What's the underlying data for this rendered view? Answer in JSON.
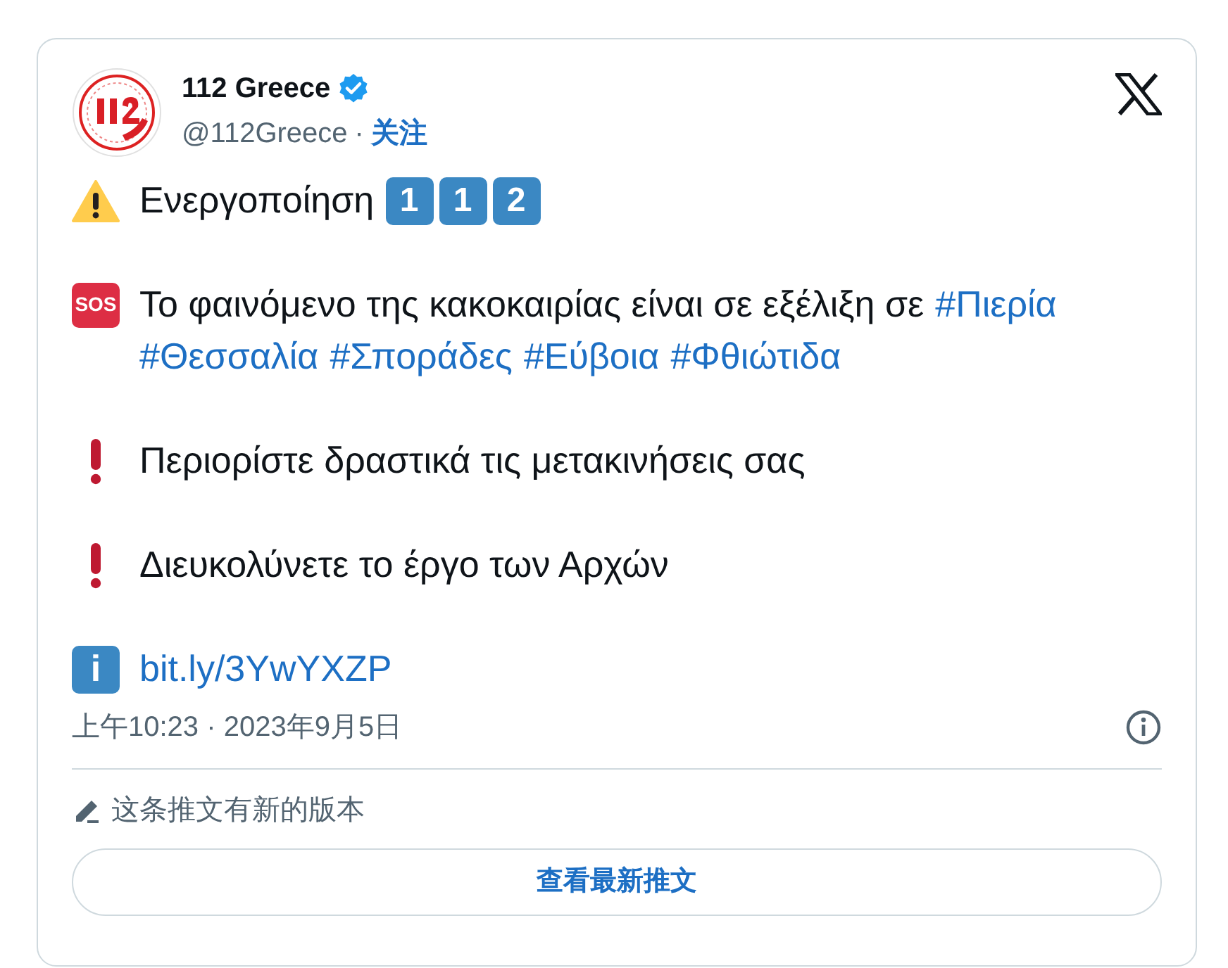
{
  "author": {
    "name": "112 Greece",
    "verified": true,
    "handle": "@112Greece",
    "separator": "·",
    "follow": "关注"
  },
  "paragraphs": [
    {
      "marker": {
        "kind": "warning"
      },
      "parts": [
        {
          "kind": "text",
          "text": "Ενεργοποίηση"
        },
        {
          "kind": "keycap",
          "text": "1"
        },
        {
          "kind": "keycap",
          "text": "1"
        },
        {
          "kind": "keycap",
          "text": "2"
        }
      ]
    },
    {
      "marker": {
        "kind": "badge",
        "text": "SOS"
      },
      "parts": [
        {
          "kind": "text",
          "text": "Το φαινόμενο της κακοκαιρίας είναι σε εξέλιξη σε"
        },
        {
          "kind": "hashtag",
          "text": "#Πιερία"
        },
        {
          "kind": "hashtag",
          "text": "#Θεσσαλία"
        },
        {
          "kind": "hashtag",
          "text": "#Σποράδες"
        },
        {
          "kind": "hashtag",
          "text": "#Εύβοια"
        },
        {
          "kind": "hashtag",
          "text": "#Φθιώτιδα"
        }
      ]
    },
    {
      "marker": {
        "kind": "exclamation"
      },
      "parts": [
        {
          "kind": "text",
          "text": "Περιορίστε δραστικά τις μετακινήσεις σας"
        }
      ]
    },
    {
      "marker": {
        "kind": "exclamation"
      },
      "parts": [
        {
          "kind": "text",
          "text": "Διευκολύνετε το έργο των Αρχών"
        }
      ]
    },
    {
      "marker": {
        "kind": "info",
        "text": "i"
      },
      "parts": [
        {
          "kind": "link",
          "text": "bit.ly/3YwYXZP"
        }
      ]
    }
  ],
  "timestamp": "上午10:23 · 2023年9月5日",
  "edited_notice": "这条推文有新的版本",
  "view_latest_button": "查看最新推文"
}
